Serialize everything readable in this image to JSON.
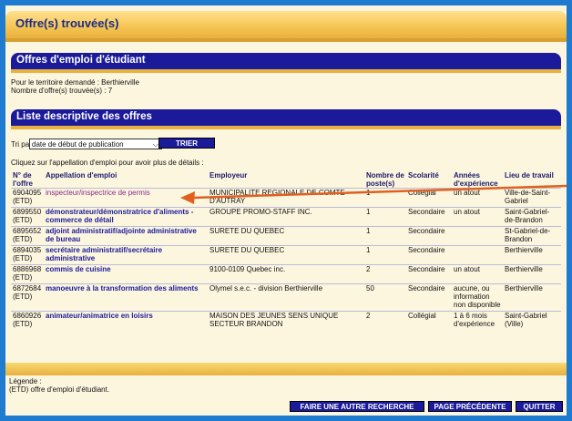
{
  "page_title": "Offre(s) trouvée(s)",
  "student_section": {
    "title": "Offres d'emploi d'étudiant",
    "territory": "Pour le territoire demandé : Berthierville",
    "count": "Nombre d'offre(s) trouvée(s) : 7"
  },
  "list_section": {
    "title": "Liste descriptive des offres",
    "sort_label": "Tri par :",
    "sort_value": "date de début de publication",
    "sort_button": "TRIER",
    "instruction": "Cliquez sur l'appellation d'emploi pour avoir plus de détails :"
  },
  "table": {
    "headers": [
      "N° de l'offre",
      "Appellation d'emploi",
      "Employeur",
      "Nombre de poste(s)",
      "Scolarité",
      "Années d'expérience",
      "Lieu de travail"
    ],
    "rows": [
      {
        "num": "6904095 (ETD)",
        "title": "inspecteur/inspectrice de permis",
        "employer": "MUNICIPALITE REGIONALE DE COMTE D'AUTRAY",
        "posts": "1",
        "school": "Collégial",
        "exp": "un atout",
        "place": "Ville-de-Saint-Gabriel"
      },
      {
        "num": "6899550 (ETD)",
        "title": "démonstrateur/démonstratrice d'aliments - commerce de détail",
        "employer": "GROUPE PROMO-STAFF INC.",
        "posts": "1",
        "school": "Secondaire",
        "exp": "un atout",
        "place": "Saint-Gabriel-de-Brandon"
      },
      {
        "num": "6895652 (ETD)",
        "title": "adjoint administratif/adjointe administrative de bureau",
        "employer": "SURETE DU QUEBEC",
        "posts": "1",
        "school": "Secondaire",
        "exp": "",
        "place": "St-Gabriel-de-Brandon"
      },
      {
        "num": "6894035 (ETD)",
        "title": "secrétaire administratif/secrétaire administrative",
        "employer": "SURETE DU QUEBEC",
        "posts": "1",
        "school": "Secondaire",
        "exp": "",
        "place": "Berthierville"
      },
      {
        "num": "6886968 (ETD)",
        "title": "commis de cuisine",
        "employer": "9100-0109 Quebec inc.",
        "posts": "2",
        "school": "Secondaire",
        "exp": "un atout",
        "place": "Berthierville"
      },
      {
        "num": "6872684 (ETD)",
        "title": "manoeuvre à la transformation des aliments",
        "employer": "Olymel s.e.c. - division Berthierville",
        "posts": "50",
        "school": "Secondaire",
        "exp": "aucune, ou information non disponible",
        "place": "Berthierville"
      },
      {
        "num": "6860926 (ETD)",
        "title": "animateur/animatrice en loisirs",
        "employer": "MAISON DES JEUNES SENS UNIQUE SECTEUR BRANDON",
        "posts": "2",
        "school": "Collégial",
        "exp": "1 à 6 mois d'expérience",
        "place": "Saint-Gabriel (Ville)"
      }
    ]
  },
  "legend": {
    "label": "Légende :",
    "text": "(ETD) offre d'emploi d'étudiant."
  },
  "buttons": {
    "new_search": "FAIRE UNE AUTRE RECHERCHE",
    "prev_page": "PAGE PRÉCÉDENTE",
    "quit": "QUITTER"
  },
  "colors": {
    "frame_blue": "#1e7bd0",
    "section_navy": "#1a1a9a",
    "gold": "#e8b040",
    "arrow": "#e06020"
  }
}
